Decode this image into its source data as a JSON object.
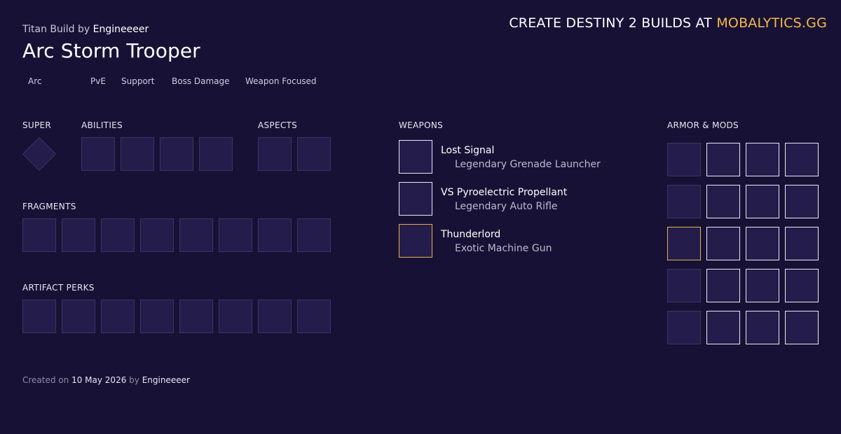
{
  "header": {
    "class_label": "Titan Build",
    "by_label": "by",
    "author": "Engineeeer",
    "title": "Arc Storm Trooper",
    "promo_text": "CREATE DESTINY 2 BUILDS AT",
    "promo_site": "MOBALYTICS.GG"
  },
  "tags": [
    "Arc",
    "PvE",
    "Support",
    "Boss Damage",
    "Weapon Focused"
  ],
  "sections": {
    "super": "SUPER",
    "abilities": "ABILITIES",
    "aspects": "ASPECTS",
    "fragments": "FRAGMENTS",
    "artifact_perks": "ARTIFACT PERKS",
    "weapons": "WEAPONS",
    "armor_mods": "ARMOR & MODS"
  },
  "weapons": [
    {
      "name": "Lost Signal",
      "type": "Legendary Grenade Launcher",
      "rarity": "legendary"
    },
    {
      "name": "VS Pyroelectric Propellant",
      "type": "Legendary Auto Rifle",
      "rarity": "legendary"
    },
    {
      "name": "Thunderlord",
      "type": "Exotic Machine Gun",
      "rarity": "exotic"
    }
  ],
  "footer": {
    "created_on_label": "Created on",
    "date": "10 May 2026",
    "by_label": "by",
    "author": "Engineeeer"
  },
  "colors": {
    "background": "#171235",
    "slot_fill": "#241d4b",
    "slot_border": "#3b3463",
    "accent_gold": "#f5b94a",
    "exotic_border": "#e6b04a"
  }
}
